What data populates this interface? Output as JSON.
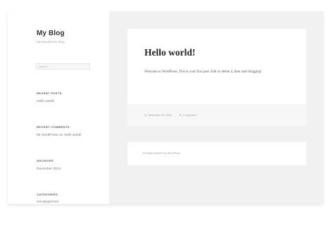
{
  "site": {
    "title": "My Blog",
    "description": "My WordPress Blog"
  },
  "search": {
    "placeholder": "Search …"
  },
  "widgets": {
    "recent_posts": {
      "title": "RECENT POSTS",
      "items": [
        "Hello world!"
      ]
    },
    "recent_comments": {
      "title": "RECENT COMMENTS",
      "items": [
        "Mr WordPress on Hello world!"
      ]
    },
    "archives": {
      "title": "ARCHIVES",
      "items": [
        "December 2014"
      ]
    },
    "categories": {
      "title": "CATEGORIES",
      "items": [
        "Uncategorized"
      ]
    }
  },
  "post": {
    "title": "Hello world!",
    "content": "Welcome to WordPress. This is your first post. Edit or delete it, then start blogging!",
    "date": "December 15, 2014",
    "comments": "1 Comment"
  },
  "footer": {
    "text": "Proudly powered by WordPress"
  },
  "colors": {
    "background": "#f1f1f1",
    "card": "#ffffff",
    "title_text": "#222222"
  },
  "icons": {
    "date": "clock-icon",
    "comments": "comment-bubble-icon"
  }
}
